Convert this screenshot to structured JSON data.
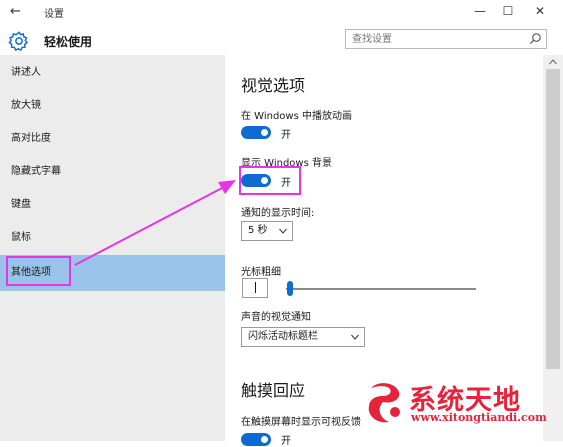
{
  "window": {
    "back_glyph": "←",
    "title": "设置",
    "minimize_glyph": "—",
    "maximize_glyph": "☐",
    "close_glyph": "✕"
  },
  "header": {
    "app_icon": "gear-icon",
    "app_name": "轻松使用",
    "search_placeholder": "查找设置",
    "search_icon": "search-icon"
  },
  "sidebar": {
    "items": [
      {
        "label": "讲述人"
      },
      {
        "label": "放大镜"
      },
      {
        "label": "高对比度"
      },
      {
        "label": "隐藏式字幕"
      },
      {
        "label": "键盘"
      },
      {
        "label": "鼠标"
      },
      {
        "label": "其他选项",
        "selected": true
      }
    ]
  },
  "main": {
    "visual_heading": "视觉选项",
    "play_animations_label": "在 Windows 中播放动画",
    "play_animations_state": "开",
    "show_background_label": "显示 Windows 背景",
    "show_background_state": "开",
    "notification_time_label": "通知的显示时间:",
    "notification_time_value": "5 秒",
    "cursor_thickness_label": "光标粗细",
    "cursor_thickness_level": 0.02,
    "visual_notification_label": "声音的视觉通知",
    "visual_notification_value": "闪烁活动标题栏",
    "touch_heading": "触摸回应",
    "touch_feedback_label": "在触摸屏幕时显示可视反馈",
    "touch_feedback_state": "开"
  },
  "watermark": {
    "brand": "系统天地",
    "url": "www.xitongtiandi.com"
  },
  "colors": {
    "accent": "#0f6bd2",
    "sidebar_bg": "#ececec",
    "selected_bg": "#99c3e9",
    "highlight": "#e535e5",
    "watermark": "#e5233a"
  }
}
